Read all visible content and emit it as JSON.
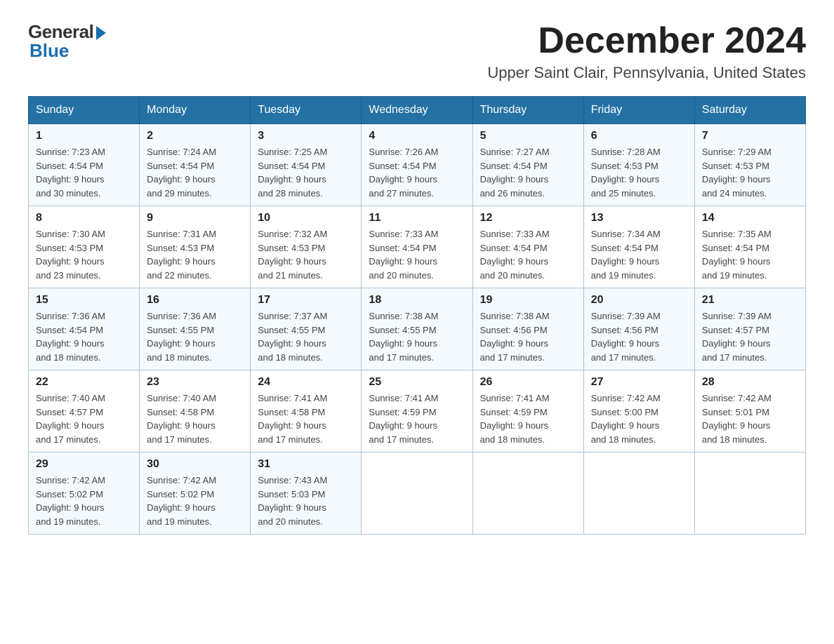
{
  "logo": {
    "general_text": "General",
    "blue_text": "Blue"
  },
  "header": {
    "month_year": "December 2024",
    "location": "Upper Saint Clair, Pennsylvania, United States"
  },
  "weekdays": [
    "Sunday",
    "Monday",
    "Tuesday",
    "Wednesday",
    "Thursday",
    "Friday",
    "Saturday"
  ],
  "weeks": [
    [
      {
        "day": "1",
        "sunrise": "7:23 AM",
        "sunset": "4:54 PM",
        "daylight": "9 hours and 30 minutes."
      },
      {
        "day": "2",
        "sunrise": "7:24 AM",
        "sunset": "4:54 PM",
        "daylight": "9 hours and 29 minutes."
      },
      {
        "day": "3",
        "sunrise": "7:25 AM",
        "sunset": "4:54 PM",
        "daylight": "9 hours and 28 minutes."
      },
      {
        "day": "4",
        "sunrise": "7:26 AM",
        "sunset": "4:54 PM",
        "daylight": "9 hours and 27 minutes."
      },
      {
        "day": "5",
        "sunrise": "7:27 AM",
        "sunset": "4:54 PM",
        "daylight": "9 hours and 26 minutes."
      },
      {
        "day": "6",
        "sunrise": "7:28 AM",
        "sunset": "4:53 PM",
        "daylight": "9 hours and 25 minutes."
      },
      {
        "day": "7",
        "sunrise": "7:29 AM",
        "sunset": "4:53 PM",
        "daylight": "9 hours and 24 minutes."
      }
    ],
    [
      {
        "day": "8",
        "sunrise": "7:30 AM",
        "sunset": "4:53 PM",
        "daylight": "9 hours and 23 minutes."
      },
      {
        "day": "9",
        "sunrise": "7:31 AM",
        "sunset": "4:53 PM",
        "daylight": "9 hours and 22 minutes."
      },
      {
        "day": "10",
        "sunrise": "7:32 AM",
        "sunset": "4:53 PM",
        "daylight": "9 hours and 21 minutes."
      },
      {
        "day": "11",
        "sunrise": "7:33 AM",
        "sunset": "4:54 PM",
        "daylight": "9 hours and 20 minutes."
      },
      {
        "day": "12",
        "sunrise": "7:33 AM",
        "sunset": "4:54 PM",
        "daylight": "9 hours and 20 minutes."
      },
      {
        "day": "13",
        "sunrise": "7:34 AM",
        "sunset": "4:54 PM",
        "daylight": "9 hours and 19 minutes."
      },
      {
        "day": "14",
        "sunrise": "7:35 AM",
        "sunset": "4:54 PM",
        "daylight": "9 hours and 19 minutes."
      }
    ],
    [
      {
        "day": "15",
        "sunrise": "7:36 AM",
        "sunset": "4:54 PM",
        "daylight": "9 hours and 18 minutes."
      },
      {
        "day": "16",
        "sunrise": "7:36 AM",
        "sunset": "4:55 PM",
        "daylight": "9 hours and 18 minutes."
      },
      {
        "day": "17",
        "sunrise": "7:37 AM",
        "sunset": "4:55 PM",
        "daylight": "9 hours and 18 minutes."
      },
      {
        "day": "18",
        "sunrise": "7:38 AM",
        "sunset": "4:55 PM",
        "daylight": "9 hours and 17 minutes."
      },
      {
        "day": "19",
        "sunrise": "7:38 AM",
        "sunset": "4:56 PM",
        "daylight": "9 hours and 17 minutes."
      },
      {
        "day": "20",
        "sunrise": "7:39 AM",
        "sunset": "4:56 PM",
        "daylight": "9 hours and 17 minutes."
      },
      {
        "day": "21",
        "sunrise": "7:39 AM",
        "sunset": "4:57 PM",
        "daylight": "9 hours and 17 minutes."
      }
    ],
    [
      {
        "day": "22",
        "sunrise": "7:40 AM",
        "sunset": "4:57 PM",
        "daylight": "9 hours and 17 minutes."
      },
      {
        "day": "23",
        "sunrise": "7:40 AM",
        "sunset": "4:58 PM",
        "daylight": "9 hours and 17 minutes."
      },
      {
        "day": "24",
        "sunrise": "7:41 AM",
        "sunset": "4:58 PM",
        "daylight": "9 hours and 17 minutes."
      },
      {
        "day": "25",
        "sunrise": "7:41 AM",
        "sunset": "4:59 PM",
        "daylight": "9 hours and 17 minutes."
      },
      {
        "day": "26",
        "sunrise": "7:41 AM",
        "sunset": "4:59 PM",
        "daylight": "9 hours and 18 minutes."
      },
      {
        "day": "27",
        "sunrise": "7:42 AM",
        "sunset": "5:00 PM",
        "daylight": "9 hours and 18 minutes."
      },
      {
        "day": "28",
        "sunrise": "7:42 AM",
        "sunset": "5:01 PM",
        "daylight": "9 hours and 18 minutes."
      }
    ],
    [
      {
        "day": "29",
        "sunrise": "7:42 AM",
        "sunset": "5:02 PM",
        "daylight": "9 hours and 19 minutes."
      },
      {
        "day": "30",
        "sunrise": "7:42 AM",
        "sunset": "5:02 PM",
        "daylight": "9 hours and 19 minutes."
      },
      {
        "day": "31",
        "sunrise": "7:43 AM",
        "sunset": "5:03 PM",
        "daylight": "9 hours and 20 minutes."
      },
      null,
      null,
      null,
      null
    ]
  ],
  "labels": {
    "sunrise": "Sunrise:",
    "sunset": "Sunset:",
    "daylight": "Daylight:"
  }
}
